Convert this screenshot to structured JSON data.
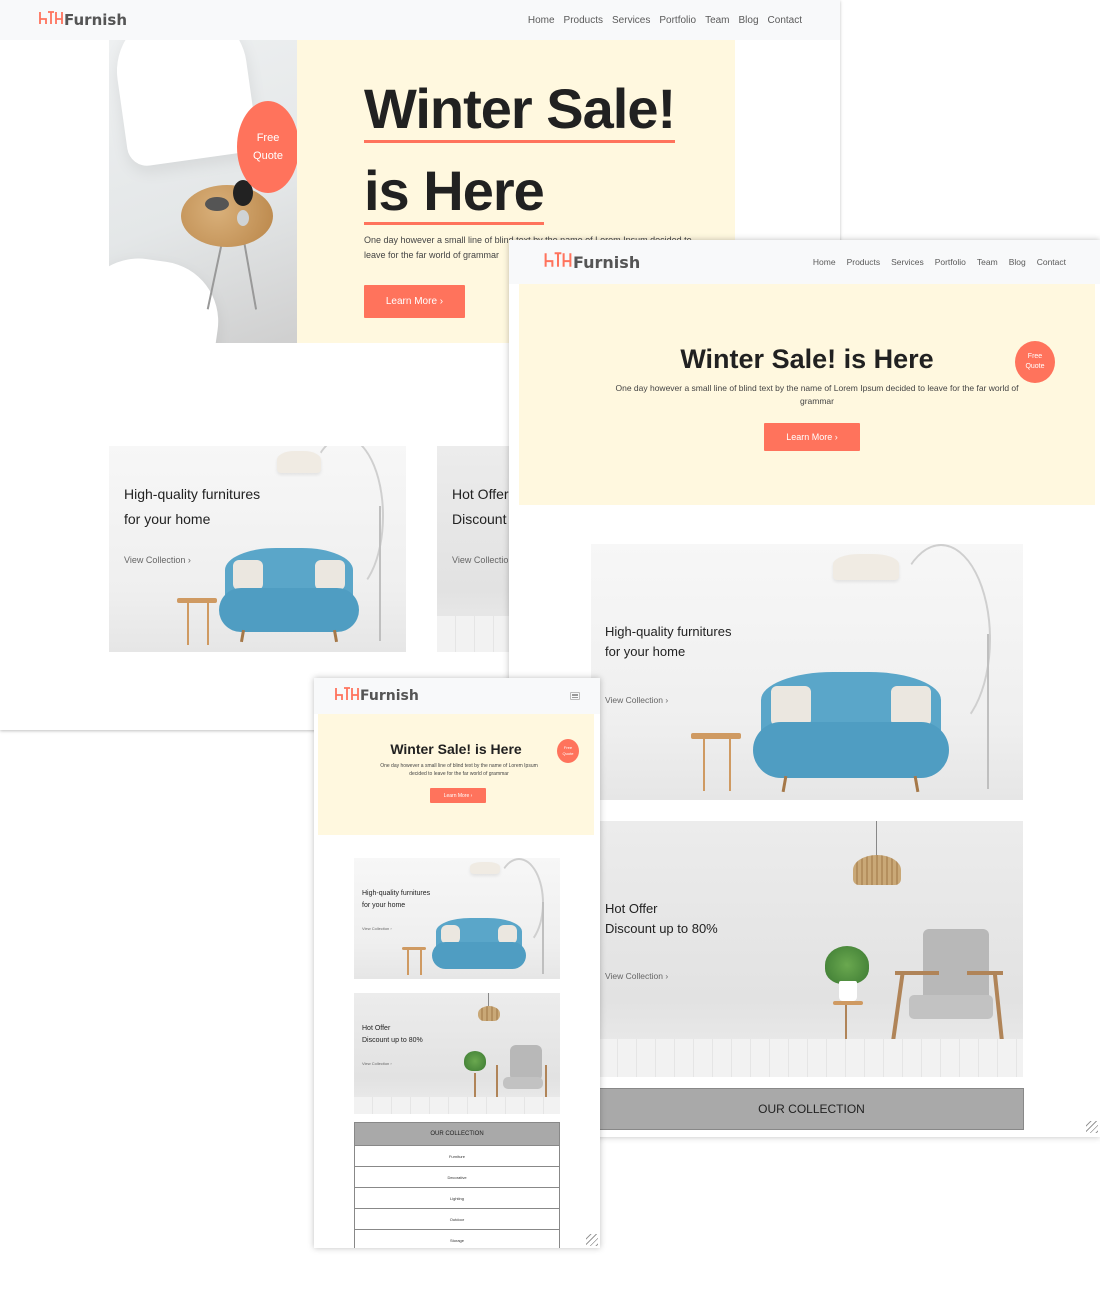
{
  "brand": {
    "name": "Furnish",
    "accent": "#ff735c",
    "hero_bg": "#fff8df"
  },
  "nav": {
    "links": [
      "Home",
      "Products",
      "Services",
      "Portfolio",
      "Team",
      "Blog",
      "Contact"
    ],
    "menu_icon": "hamburger-icon"
  },
  "hero": {
    "title_line1": "Winter Sale!",
    "title_line2": "is Here",
    "title_full": "Winter Sale! is Here",
    "badge_line1": "Free",
    "badge_line2": "Quote",
    "text": "One day however a small line of blind text by the name of Lorem Ipsum decided to leave for the far world of grammar",
    "text_truncated": "One day however a small line of blind text by the name of Lorem Ipsum decided to leave for the far world of grammar",
    "button": "Learn More ›"
  },
  "cards": [
    {
      "line1": "High-quality furnitures",
      "line2": "for your home",
      "link": "View Collection ›"
    },
    {
      "line1": "Hot Offer",
      "line2": "Discount up to 80%",
      "link": "View Collection ›"
    }
  ],
  "collection": {
    "title": "OUR COLLECTION",
    "items": [
      "Furniture",
      "Decorative",
      "Lighting",
      "Outdoor",
      "Storage"
    ]
  }
}
